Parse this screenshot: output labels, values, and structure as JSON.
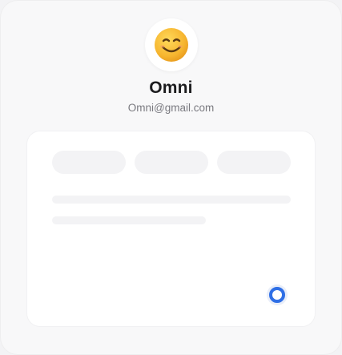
{
  "profile": {
    "avatar_icon": "smiling-face-emoji",
    "name": "Omni",
    "email": "Omni@gmail.com"
  },
  "card": {
    "state": "loading",
    "placeholder_tabs": 3,
    "placeholder_lines": 2
  },
  "colors": {
    "background": "#f8f8f9",
    "card": "#ffffff",
    "skeleton": "#f3f3f5",
    "name_text": "#1c1c1e",
    "email_text": "#7a7a80",
    "spinner_accent": "#2f6fe6",
    "emoji_face": "#f7b733"
  },
  "spinner_icon": "loading-spinner-icon"
}
